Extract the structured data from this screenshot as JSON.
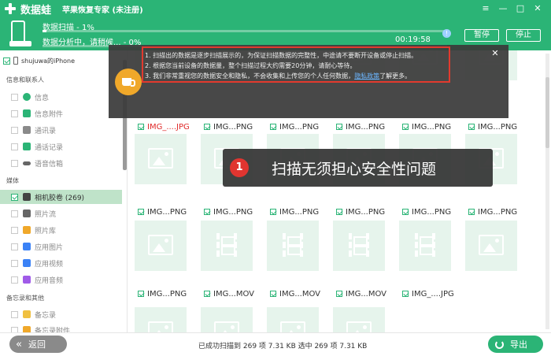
{
  "app": {
    "brand": "数据蛙",
    "subtitle": "苹果恢复专家 (未注册)",
    "window_buttons": [
      "≡",
      "—",
      "□",
      "✕"
    ]
  },
  "scan": {
    "line1": "数据扫描 - 1%",
    "line1_progress": 0.01,
    "line2": "数据分析中，请稍候... - 0%",
    "line2_progress": 0.0,
    "elapsed": "00:19:58",
    "info_icon": "!",
    "pause_label": "暂停",
    "stop_label": "停止"
  },
  "sidebar": {
    "device": "shujuwa的iPhone",
    "categories": [
      {
        "label": "信息和联系人"
      },
      {
        "label": "媒体"
      },
      {
        "label": "备忘录和其他"
      }
    ],
    "items": [
      {
        "label": "信息",
        "icon": "message-icon",
        "color": "#2bb476"
      },
      {
        "label": "信息附件",
        "icon": "attachment-icon",
        "color": "#2bb476"
      },
      {
        "label": "通讯录",
        "icon": "contacts-icon",
        "color": "#8a8a8a"
      },
      {
        "label": "通话记录",
        "icon": "phone-icon",
        "color": "#2bb476"
      },
      {
        "label": "语音信箱",
        "icon": "voicemail-icon",
        "color": "#666666"
      },
      {
        "label": "相机胶卷 (269)",
        "icon": "camera-icon",
        "color": "#444444"
      },
      {
        "label": "照片流",
        "icon": "photostream-icon",
        "color": "#666666"
      },
      {
        "label": "照片库",
        "icon": "gallery-icon",
        "color": "#f0a82a"
      },
      {
        "label": "应用图片",
        "icon": "app-image-icon",
        "color": "#3b82f6"
      },
      {
        "label": "应用视频",
        "icon": "app-video-icon",
        "color": "#3b82f6"
      },
      {
        "label": "应用音频",
        "icon": "app-audio-icon",
        "color": "#a05be8"
      },
      {
        "label": "备忘录",
        "icon": "notes-icon",
        "color": "#f0c040"
      },
      {
        "label": "备忘录附件",
        "icon": "notes-attachment-icon",
        "color": "#f0a82a"
      }
    ]
  },
  "grid": {
    "files": [
      {
        "name": "IMG_....JPG",
        "type": "photo"
      },
      {
        "name": "IMG...PNG",
        "type": "photo"
      },
      {
        "name": "IMG...PNG",
        "type": "photo"
      },
      {
        "name": "IMG...PNG",
        "type": "photo"
      },
      {
        "name": "IMG...PNG",
        "type": "photo"
      },
      {
        "name": "IMG...PNG",
        "type": "photo"
      },
      {
        "name": "IMG...PNG",
        "type": "photo"
      },
      {
        "name": "IMG...PNG",
        "type": "photo"
      },
      {
        "name": "IMG...PNG",
        "type": "photo"
      },
      {
        "name": "IMG...PNG",
        "type": "photo"
      },
      {
        "name": "IMG...PNG",
        "type": "photo"
      },
      {
        "name": "IMG...PNG",
        "type": "photo"
      },
      {
        "name": "IMG...PNG",
        "type": "photo"
      },
      {
        "name": "IMG...MOV",
        "type": "video"
      },
      {
        "name": "IMG...MOV",
        "type": "video"
      },
      {
        "name": "IMG...MOV",
        "type": "video"
      },
      {
        "name": "IMG_....JPG",
        "type": "video"
      },
      {
        "name": "",
        "type": "photo"
      },
      {
        "name": "",
        "type": "photo"
      },
      {
        "name": "",
        "type": "photo"
      },
      {
        "name": "",
        "type": "photo"
      },
      {
        "name": "",
        "type": "photo"
      }
    ]
  },
  "notice": {
    "lines": [
      "1. 扫描出的数据是逐步扫描展示的，为保证扫描数据的完整性，中途请不要断开设备或停止扫描。",
      "2. 根据您当前设备的数据量，整个扫描过程大约需要20分钟，请耐心等待。",
      "3. 我们非常重视您的数据安全和隐私，不会收集和上传您的个人任何数据，"
    ],
    "link": "隐私政策",
    "link_suffix": "了解更多。",
    "close": "✕"
  },
  "callout": {
    "number": "1",
    "text": "扫描无须担心安全性问题"
  },
  "footer": {
    "back_label": "返回",
    "back_icon": "«",
    "status": "已成功扫描到 269 项 7.31 KB  选中 269 项 7.31 KB",
    "export_label": "导出"
  }
}
